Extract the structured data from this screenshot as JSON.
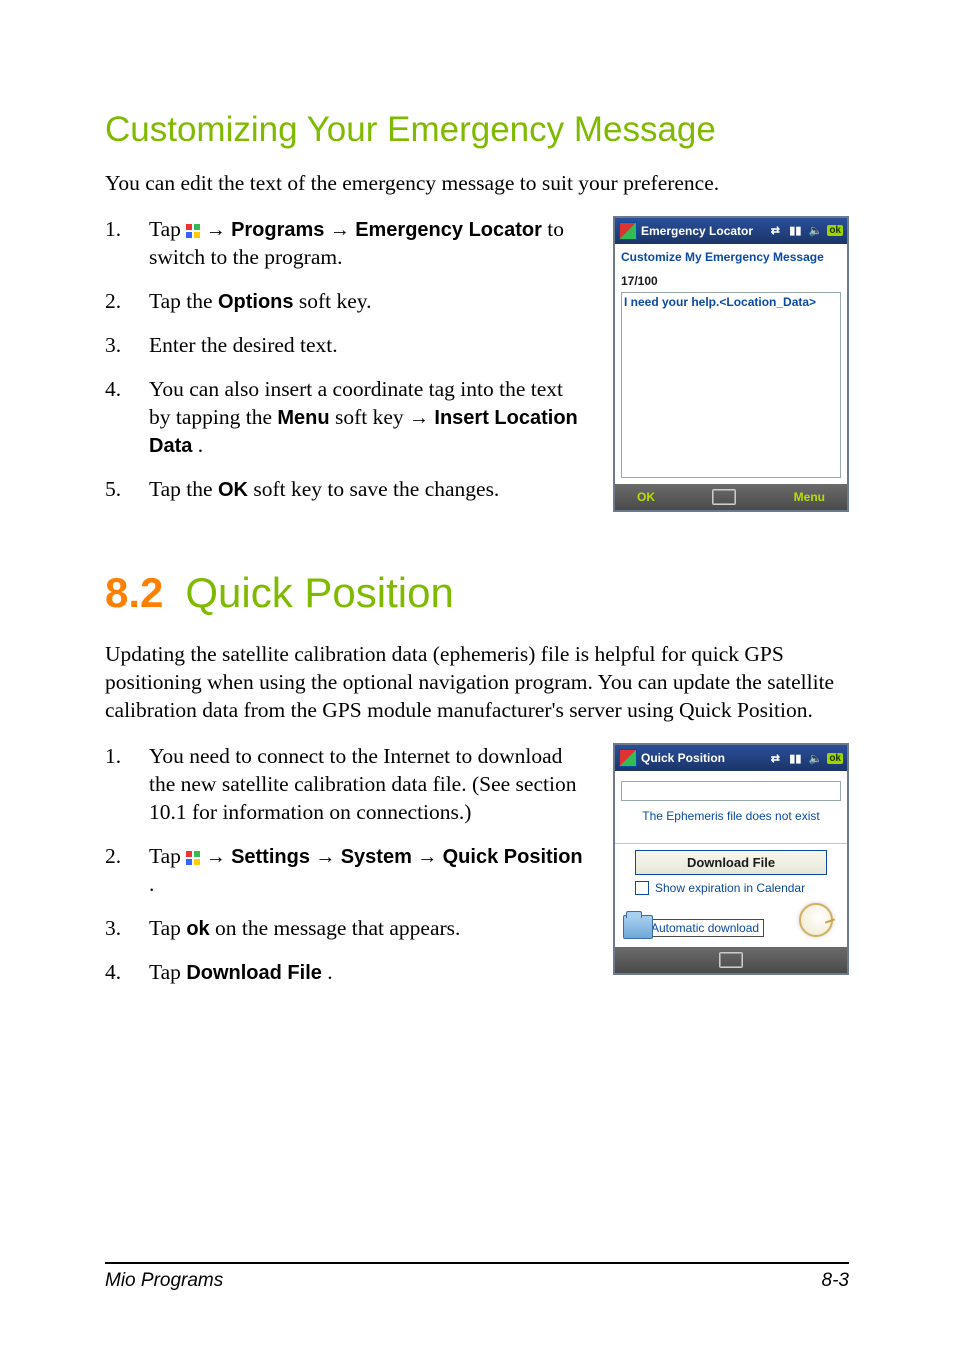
{
  "headings": {
    "h2_1": "Customizing Your Emergency Message",
    "h1_num": "8.2",
    "h1_title": "Quick Position"
  },
  "section1": {
    "intro": "You can edit the text of the emergency message to suit your preference.",
    "steps": [
      {
        "n": "1.",
        "pre": "Tap ",
        "path": [
          "Programs",
          "Emergency Locator"
        ],
        "post": " to switch to the program."
      },
      {
        "n": "2.",
        "pre": "Tap the ",
        "bold1": "Options",
        "post": " soft key."
      },
      {
        "n": "3.",
        "text": "Enter the desired text."
      },
      {
        "n": "4.",
        "pre": "You can also insert a coordinate tag into the text by tapping the ",
        "bold1": "Menu",
        "mid": " soft key ",
        "arrow_then": true,
        "bold2": "Insert Location Data",
        "post": "."
      },
      {
        "n": "5.",
        "pre": "Tap the ",
        "bold1": "OK",
        "post": " soft key to save the changes."
      }
    ]
  },
  "section2": {
    "intro": "Updating the satellite calibration data (ephemeris) file is helpful for quick GPS positioning when using the optional navigation program. You can update the satellite calibration data from the GPS module manufacturer's server using Quick Position.",
    "steps": [
      {
        "n": "1.",
        "text": "You need to connect to the Internet to download the new satellite calibration data file. (See section 10.1 for information on connections.)"
      },
      {
        "n": "2.",
        "pre": "Tap ",
        "path": [
          "Settings",
          "System",
          "Quick Position"
        ],
        "post": "."
      },
      {
        "n": "3.",
        "pre": "Tap ",
        "bold1": "ok",
        "post": " on the message that appears."
      },
      {
        "n": "4.",
        "pre": "Tap ",
        "bold1": "Download File",
        "post": "."
      }
    ]
  },
  "screenshot1": {
    "title": "Emergency Locator",
    "ok": "ok",
    "subtitle": "Customize My Emergency Message",
    "counter": "17/100",
    "editor_text": "I need your help.<Location_Data>",
    "soft_left": "OK",
    "soft_right": "Menu"
  },
  "screenshot2": {
    "title": "Quick Position",
    "ok": "ok",
    "status_line": "The Ephemeris file does not exist",
    "download_btn": "Download File",
    "chk1": "Show expiration in Calendar",
    "chk2": "Automatic download"
  },
  "footer": {
    "left": "Mio Programs",
    "right": "8-3"
  },
  "glyphs": {
    "arrow": "→"
  }
}
